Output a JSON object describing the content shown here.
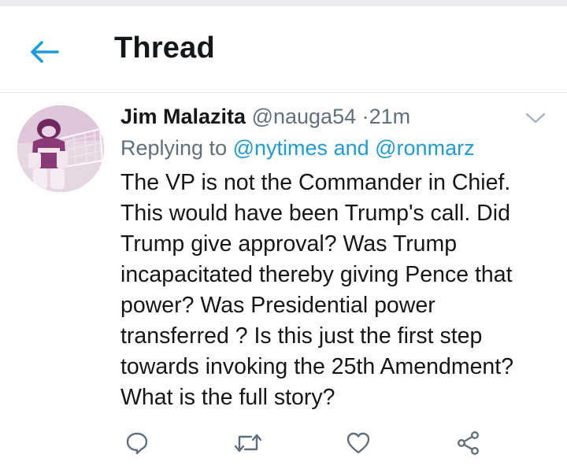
{
  "header": {
    "title": "Thread",
    "back_icon": "arrow-left-icon"
  },
  "colors": {
    "accent": "#1d9bd7",
    "muted": "#5f6f7c",
    "text": "#14171a",
    "divider": "#e1e8ed"
  },
  "tweet": {
    "author_name": "Jim Malazita",
    "handle": "@nauga54",
    "separator": "·",
    "time": "21m",
    "replying_prefix": "Replying to",
    "mention_1": "@nytimes",
    "and": "and",
    "mention_2": "@ronmarz",
    "body_lines": [
      "The VP is not the Commander in Chief.",
      "This would have been Trump's call. Did",
      "Trump give approval? Was Trump",
      "incapacitated thereby giving Pence that",
      "power? Was Presidential power",
      "transferred ? Is this just the first step",
      "towards invoking the 25th Amendment?",
      "What is the full story?"
    ]
  },
  "actions": {
    "icons": [
      "reply-icon",
      "retweet-icon",
      "like-icon",
      "share-icon"
    ]
  }
}
